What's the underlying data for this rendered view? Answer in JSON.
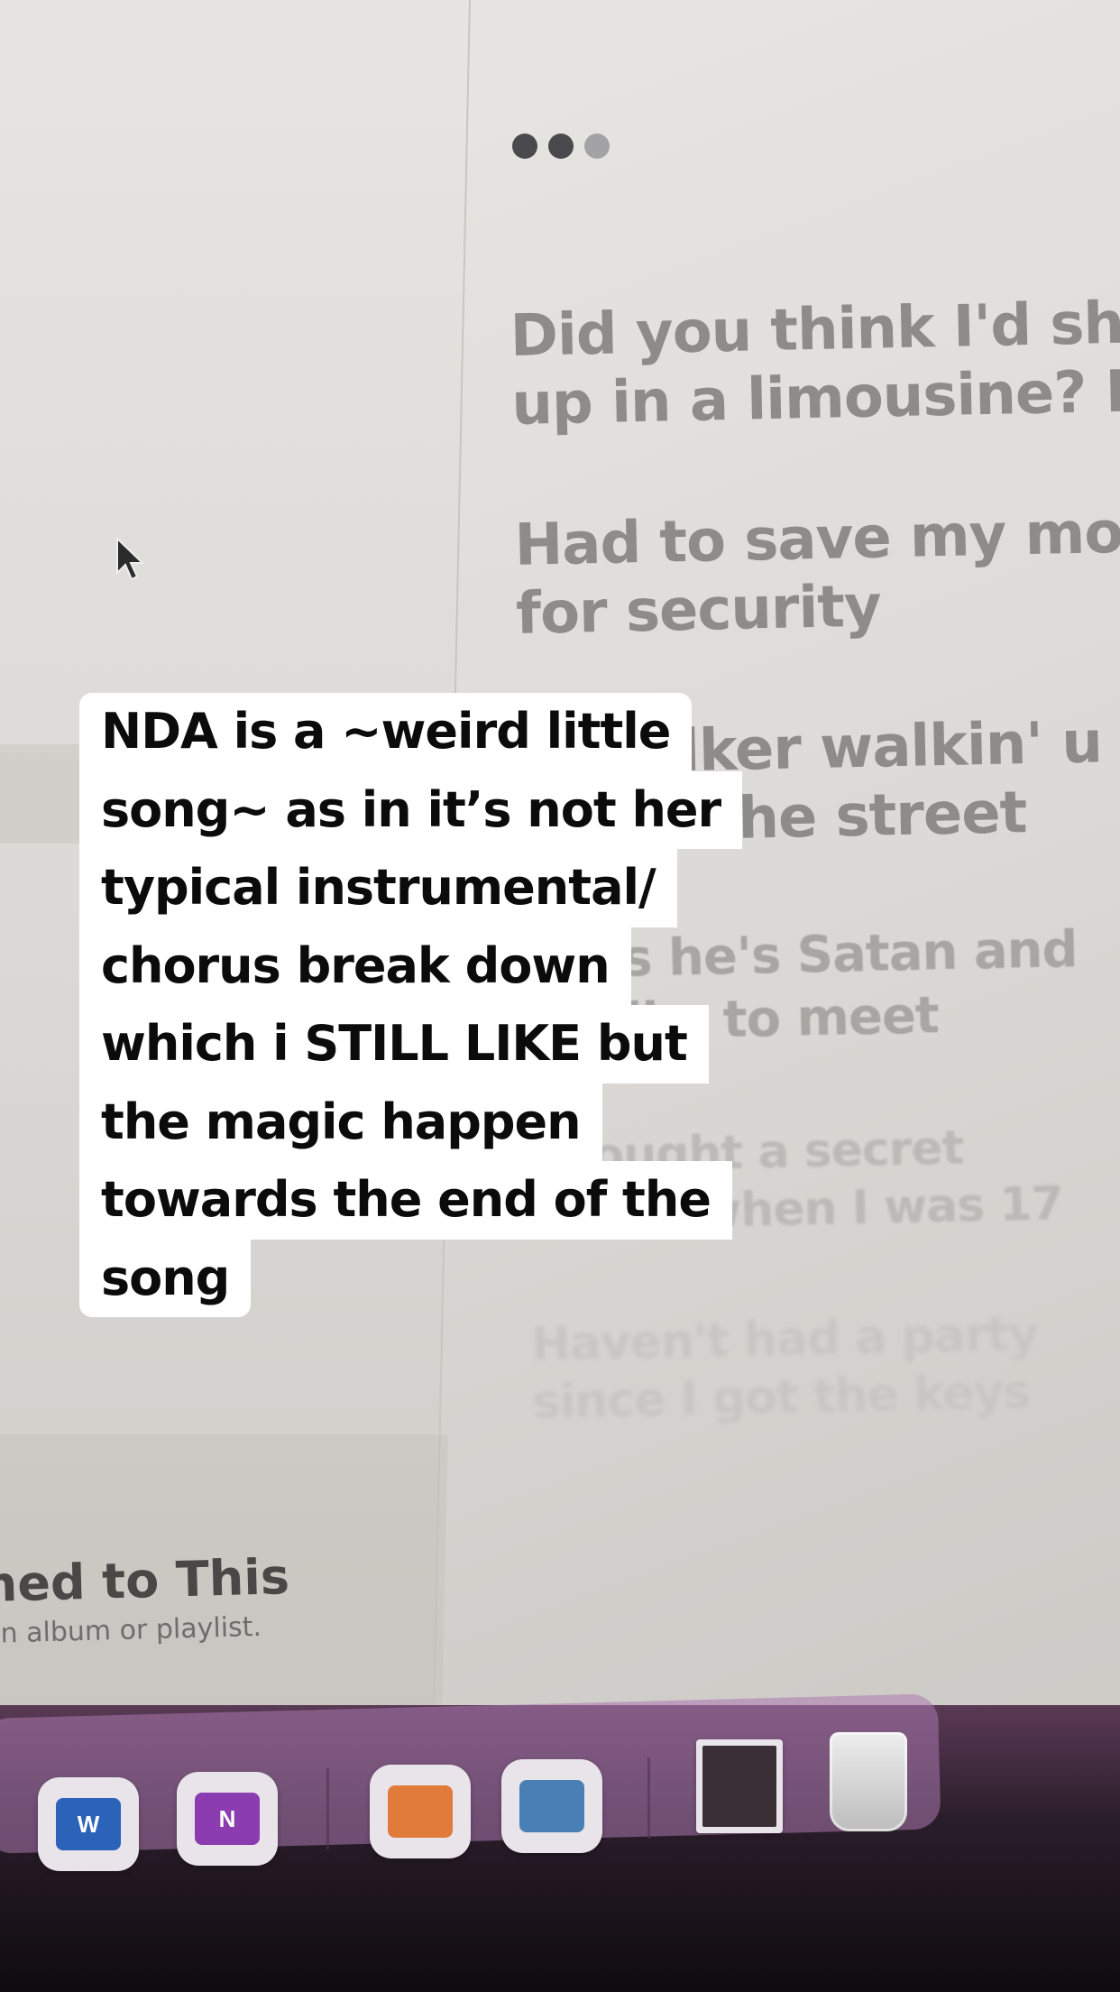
{
  "player": {
    "dot_colors": [
      "#4a4a4e",
      "#4a4a4e",
      "#a3a3a6"
    ],
    "lyrics": [
      "Did you think I'd sho",
      "up in a limousine? No",
      "Had to save my mone",
      "for security",
      "A stalker walkin' u",
      "down the street",
      "Says he's Satan and",
      "I'd like to meet",
      "I bought a secret",
      "house when I was 17",
      "Haven't had a party",
      "since I got the keys"
    ]
  },
  "library": {
    "empty_title": "ned to This",
    "empty_subtitle": "an album or playlist."
  },
  "dock": {
    "apps": [
      {
        "name": "word-icon",
        "letter": "W",
        "color": "#2b63b8"
      },
      {
        "name": "onenote-icon",
        "letter": "N",
        "color": "#8a3cb0"
      },
      {
        "name": "pixelmator-icon",
        "letter": "",
        "color": "#e07b3c"
      },
      {
        "name": "preview-icon",
        "letter": "",
        "color": "#4a7fb5"
      },
      {
        "name": "photo-thumbnail-icon",
        "letter": "",
        "color": "#3a2f35"
      }
    ]
  },
  "story_text": [
    "NDA is a ~weird little",
    "song~ as in it’s not her",
    "typical instrumental/",
    "chorus break down",
    "which i STILL LIKE but",
    "the magic happen",
    "towards the end of the",
    "song"
  ]
}
